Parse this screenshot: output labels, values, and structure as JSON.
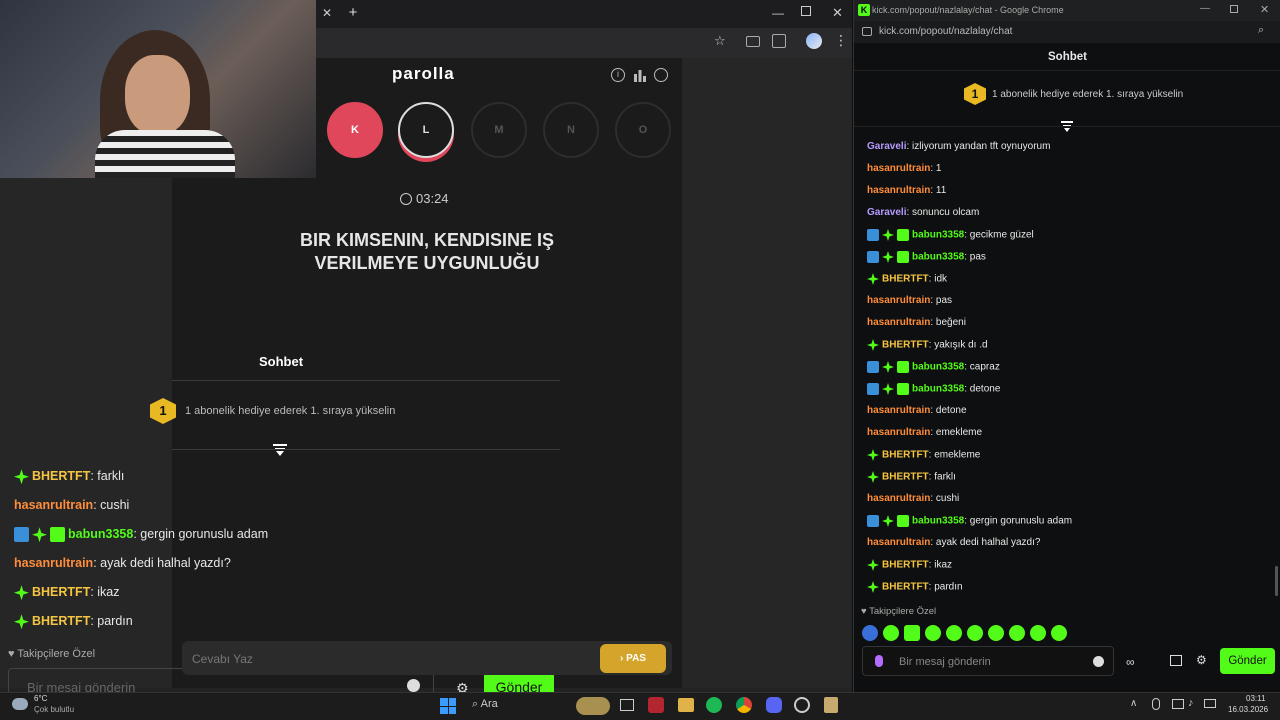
{
  "left_window": {
    "tab_plus": "+",
    "tab_close": "✕",
    "game_title": "parolla",
    "letters": [
      {
        "label": "K",
        "state": "done"
      },
      {
        "label": "L",
        "state": "active"
      },
      {
        "label": "M",
        "state": "idle"
      },
      {
        "label": "N",
        "state": "idle"
      },
      {
        "label": "O",
        "state": "idle"
      }
    ],
    "timer": "03:24",
    "question_line1": "BIR KIMSENIN, KENDISINE IŞ",
    "question_line2": "VERILMEYE UYGUNLUĞU",
    "answer_placeholder": "Cevabı Yaz",
    "pass_button": "PAS"
  },
  "overlay_chat": {
    "title": "Sohbet",
    "sub_banner_number": "1",
    "sub_banner": "1 abonelik hediye ederek 1. sıraya yükselin",
    "messages": [
      {
        "user": "BHERTFT",
        "text": ": farklı",
        "color": "yellow",
        "badges": [
          "star"
        ]
      },
      {
        "user": "hasanrultrain",
        "text": ": cushi",
        "color": "orange",
        "badges": []
      },
      {
        "user": "babun3358",
        "text": ": gergin gorunuslu adam",
        "color": "green",
        "badges": [
          "sq",
          "star",
          "gift"
        ]
      },
      {
        "user": "hasanrultrain",
        "text": ": ayak dedi halhal yazdı?",
        "color": "orange",
        "badges": []
      },
      {
        "user": "BHERTFT",
        "text": ": ikaz",
        "color": "yellow",
        "badges": [
          "star"
        ]
      },
      {
        "user": "BHERTFT",
        "text": ": pardın",
        "color": "yellow",
        "badges": [
          "star"
        ]
      }
    ],
    "followers_only": "Takipçilere Özel",
    "input_placeholder": "Bir mesaj gönderin",
    "send_button": "Gönder"
  },
  "right_window": {
    "title": "kick.com/popout/nazlalay/chat - Google Chrome",
    "url": "kick.com/popout/nazlalay/chat",
    "chat_title": "Sohbet",
    "sub_banner_number": "1",
    "sub_banner": "1 abonelik hediye ederek 1. sıraya yükselin",
    "messages": [
      {
        "user": "Garaveli",
        "text": ": izliyorum yandan tft oynuyorum",
        "color": "purple",
        "badges": []
      },
      {
        "user": "hasanrultrain",
        "text": ": 1",
        "color": "orange",
        "badges": []
      },
      {
        "user": "hasanrultrain",
        "text": ": 11",
        "color": "orange",
        "badges": []
      },
      {
        "user": "Garaveli",
        "text": ": sonuncu olcam",
        "color": "purple",
        "badges": []
      },
      {
        "user": "babun3358",
        "text": ": gecikme güzel",
        "color": "green",
        "badges": [
          "sq",
          "star",
          "gift"
        ]
      },
      {
        "user": "babun3358",
        "text": ": pas",
        "color": "green",
        "badges": [
          "sq",
          "star",
          "gift"
        ]
      },
      {
        "user": "BHERTFT",
        "text": ": idk",
        "color": "yellow",
        "badges": [
          "star"
        ]
      },
      {
        "user": "hasanrultrain",
        "text": ": pas",
        "color": "orange",
        "badges": []
      },
      {
        "user": "hasanrultrain",
        "text": ": beğeni",
        "color": "orange",
        "badges": []
      },
      {
        "user": "BHERTFT",
        "text": ": yakışık dı .d",
        "color": "yellow",
        "badges": [
          "star"
        ]
      },
      {
        "user": "babun3358",
        "text": ": capraz",
        "color": "green",
        "badges": [
          "sq",
          "star",
          "gift"
        ]
      },
      {
        "user": "babun3358",
        "text": ": detone",
        "color": "green",
        "badges": [
          "sq",
          "star",
          "gift"
        ]
      },
      {
        "user": "hasanrultrain",
        "text": ": detone",
        "color": "orange",
        "badges": []
      },
      {
        "user": "hasanrultrain",
        "text": ": emekleme",
        "color": "orange",
        "badges": []
      },
      {
        "user": "BHERTFT",
        "text": ": emekleme",
        "color": "yellow",
        "badges": [
          "star"
        ]
      },
      {
        "user": "BHERTFT",
        "text": ": farklı",
        "color": "yellow",
        "badges": [
          "star"
        ]
      },
      {
        "user": "hasanrultrain",
        "text": ": cushi",
        "color": "orange",
        "badges": []
      },
      {
        "user": "babun3358",
        "text": ": gergin gorunuslu adam",
        "color": "green",
        "badges": [
          "sq",
          "star",
          "gift"
        ]
      },
      {
        "user": "hasanrultrain",
        "text": ": ayak dedi halhal yazdı?",
        "color": "orange",
        "badges": []
      },
      {
        "user": "BHERTFT",
        "text": ": ikaz",
        "color": "yellow",
        "badges": [
          "star"
        ]
      },
      {
        "user": "BHERTFT",
        "text": ": pardın",
        "color": "yellow",
        "badges": [
          "star"
        ]
      }
    ],
    "followers_only": "Takipçilere Özel",
    "input_placeholder": "Bir mesaj gönderin",
    "send_button": "Gönder"
  },
  "taskbar": {
    "weather_temp": "6°C",
    "weather_desc": "Çok bulutlu",
    "search_label": "Ara",
    "time": "03:11",
    "date": "16.03.2026"
  }
}
